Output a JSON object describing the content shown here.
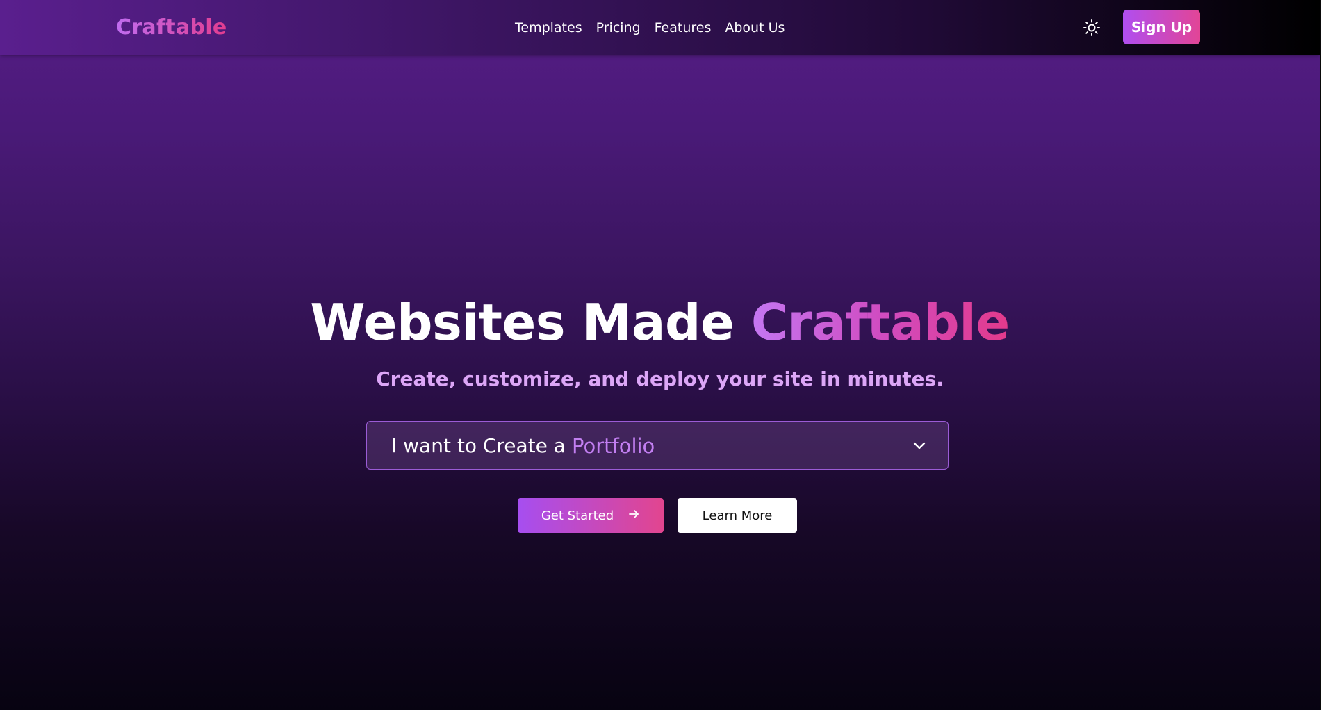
{
  "header": {
    "logo": "Craftable",
    "nav": [
      {
        "label": "Templates"
      },
      {
        "label": "Pricing"
      },
      {
        "label": "Features"
      },
      {
        "label": "About Us"
      }
    ],
    "theme_icon": "sun-icon",
    "signup_label": "Sign Up"
  },
  "hero": {
    "title_main": "Websites Made ",
    "title_accent": "Craftable",
    "subtitle": "Create, customize, and deploy your site in minutes.",
    "selector": {
      "prefix": "I want to Create a",
      "value": "Portfolio",
      "icon": "chevron-down-icon"
    },
    "primary_button": {
      "label": "Get Started",
      "icon": "arrow-right-icon"
    },
    "secondary_button": {
      "label": "Learn More"
    }
  },
  "colors": {
    "accent_start": "#b04ef0",
    "accent_end": "#e2458f",
    "subtitle": "#dca6f7",
    "selector_value": "#c27ff1"
  }
}
